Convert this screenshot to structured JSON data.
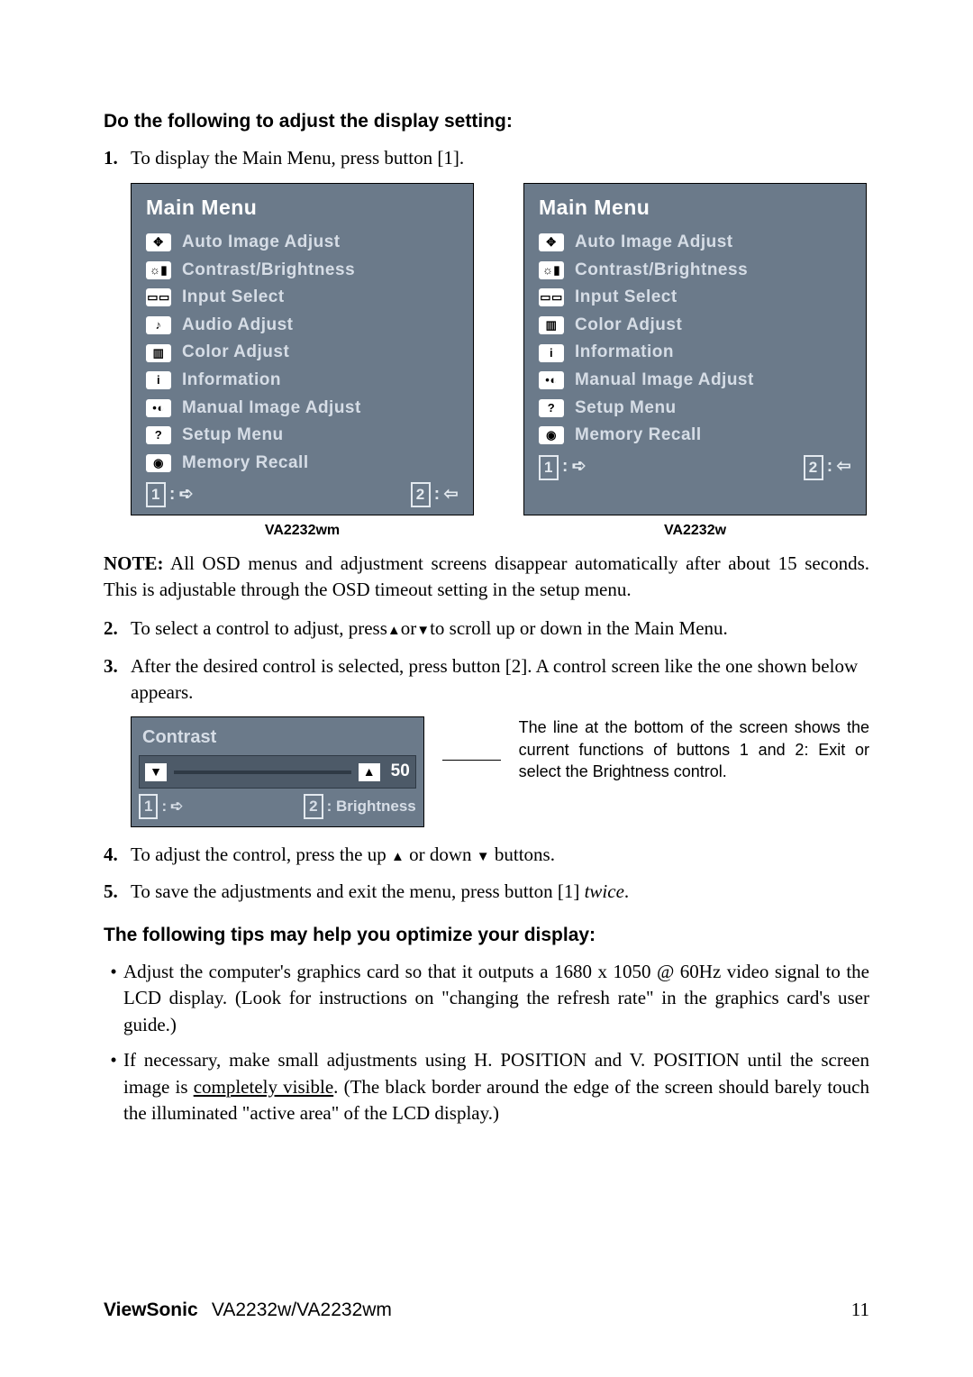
{
  "section1": {
    "heading": "Do the following to adjust the display setting:",
    "step1": "To display the Main Menu, press button [1]."
  },
  "osd_left": {
    "title": "Main Menu",
    "items": [
      {
        "icon": "auto-adjust-icon",
        "glyph": "✥",
        "label": "Auto Image Adjust"
      },
      {
        "icon": "contrast-icon",
        "glyph": "☼▮",
        "label": "Contrast/Brightness"
      },
      {
        "icon": "input-icon",
        "glyph": "▭▭",
        "label": "Input Select"
      },
      {
        "icon": "audio-icon",
        "glyph": "♪",
        "label": "Audio Adjust"
      },
      {
        "icon": "color-icon",
        "glyph": "▥",
        "label": "Color Adjust"
      },
      {
        "icon": "info-icon",
        "glyph": "i",
        "label": "Information"
      },
      {
        "icon": "manual-icon",
        "glyph": "•◐",
        "label": "Manual Image Adjust"
      },
      {
        "icon": "setup-icon",
        "glyph": "?",
        "label": "Setup Menu"
      },
      {
        "icon": "memory-icon",
        "glyph": "◉",
        "label": "Memory Recall"
      }
    ],
    "foot1": "1",
    "foot2": "2"
  },
  "osd_right": {
    "title": "Main Menu",
    "items": [
      {
        "icon": "auto-adjust-icon",
        "glyph": "✥",
        "label": "Auto Image Adjust"
      },
      {
        "icon": "contrast-icon",
        "glyph": "☼▮",
        "label": "Contrast/Brightness"
      },
      {
        "icon": "input-icon",
        "glyph": "▭▭",
        "label": "Input Select"
      },
      {
        "icon": "color-icon",
        "glyph": "▥",
        "label": "Color Adjust"
      },
      {
        "icon": "info-icon",
        "glyph": "i",
        "label": "Information"
      },
      {
        "icon": "manual-icon",
        "glyph": "•◐",
        "label": "Manual Image Adjust"
      },
      {
        "icon": "setup-icon",
        "glyph": "?",
        "label": "Setup Menu"
      },
      {
        "icon": "memory-icon",
        "glyph": "◉",
        "label": "Memory Recall"
      }
    ],
    "foot1": "1",
    "foot2": "2"
  },
  "models": {
    "left": "VA2232wm",
    "right": "VA2232w"
  },
  "note": {
    "label": "NOTE:",
    "text": " All OSD menus and adjustment screens disappear automatically after about 15 seconds. This is adjustable through the OSD timeout setting in the setup menu."
  },
  "step2_a": "To select a control to adjust, press",
  "step2_b": "or",
  "step2_c": "to scroll up or down in the Main Menu.",
  "step3": "After the desired control is selected, press button [2]. A control screen like the one shown below appears.",
  "contrast": {
    "title": "Contrast",
    "value": "50",
    "foot1": "1",
    "foot2_label": ": Brightness",
    "foot2": "2"
  },
  "callout": "The line at the bottom of the screen shows the current functions of buttons 1 and 2: Exit or select the Brightness control.",
  "step4_a": "To adjust the control, press the up ",
  "step4_b": " or down ",
  "step4_c": " buttons.",
  "step5_a": "To save the adjustments and exit the menu, press button [1] ",
  "step5_b": "twice",
  "step5_c": ".",
  "section2": {
    "heading": "The following tips may help you optimize your display:",
    "tip1": "Adjust the computer's graphics card so that it outputs a 1680 x 1050 @ 60Hz video signal to the LCD display. (Look for instructions on \"changing the refresh rate\" in the graphics card's user guide.)",
    "tip2_a": "If necessary, make small adjustments using H. POSITION and V. POSITION until the screen image is ",
    "tip2_u": "completely visible",
    "tip2_b": ". (The black border around the edge of the screen should barely touch the illuminated \"active area\" of the LCD display.)"
  },
  "footer": {
    "brand": "ViewSonic",
    "models": "VA2232w/VA2232wm",
    "page": "11"
  }
}
